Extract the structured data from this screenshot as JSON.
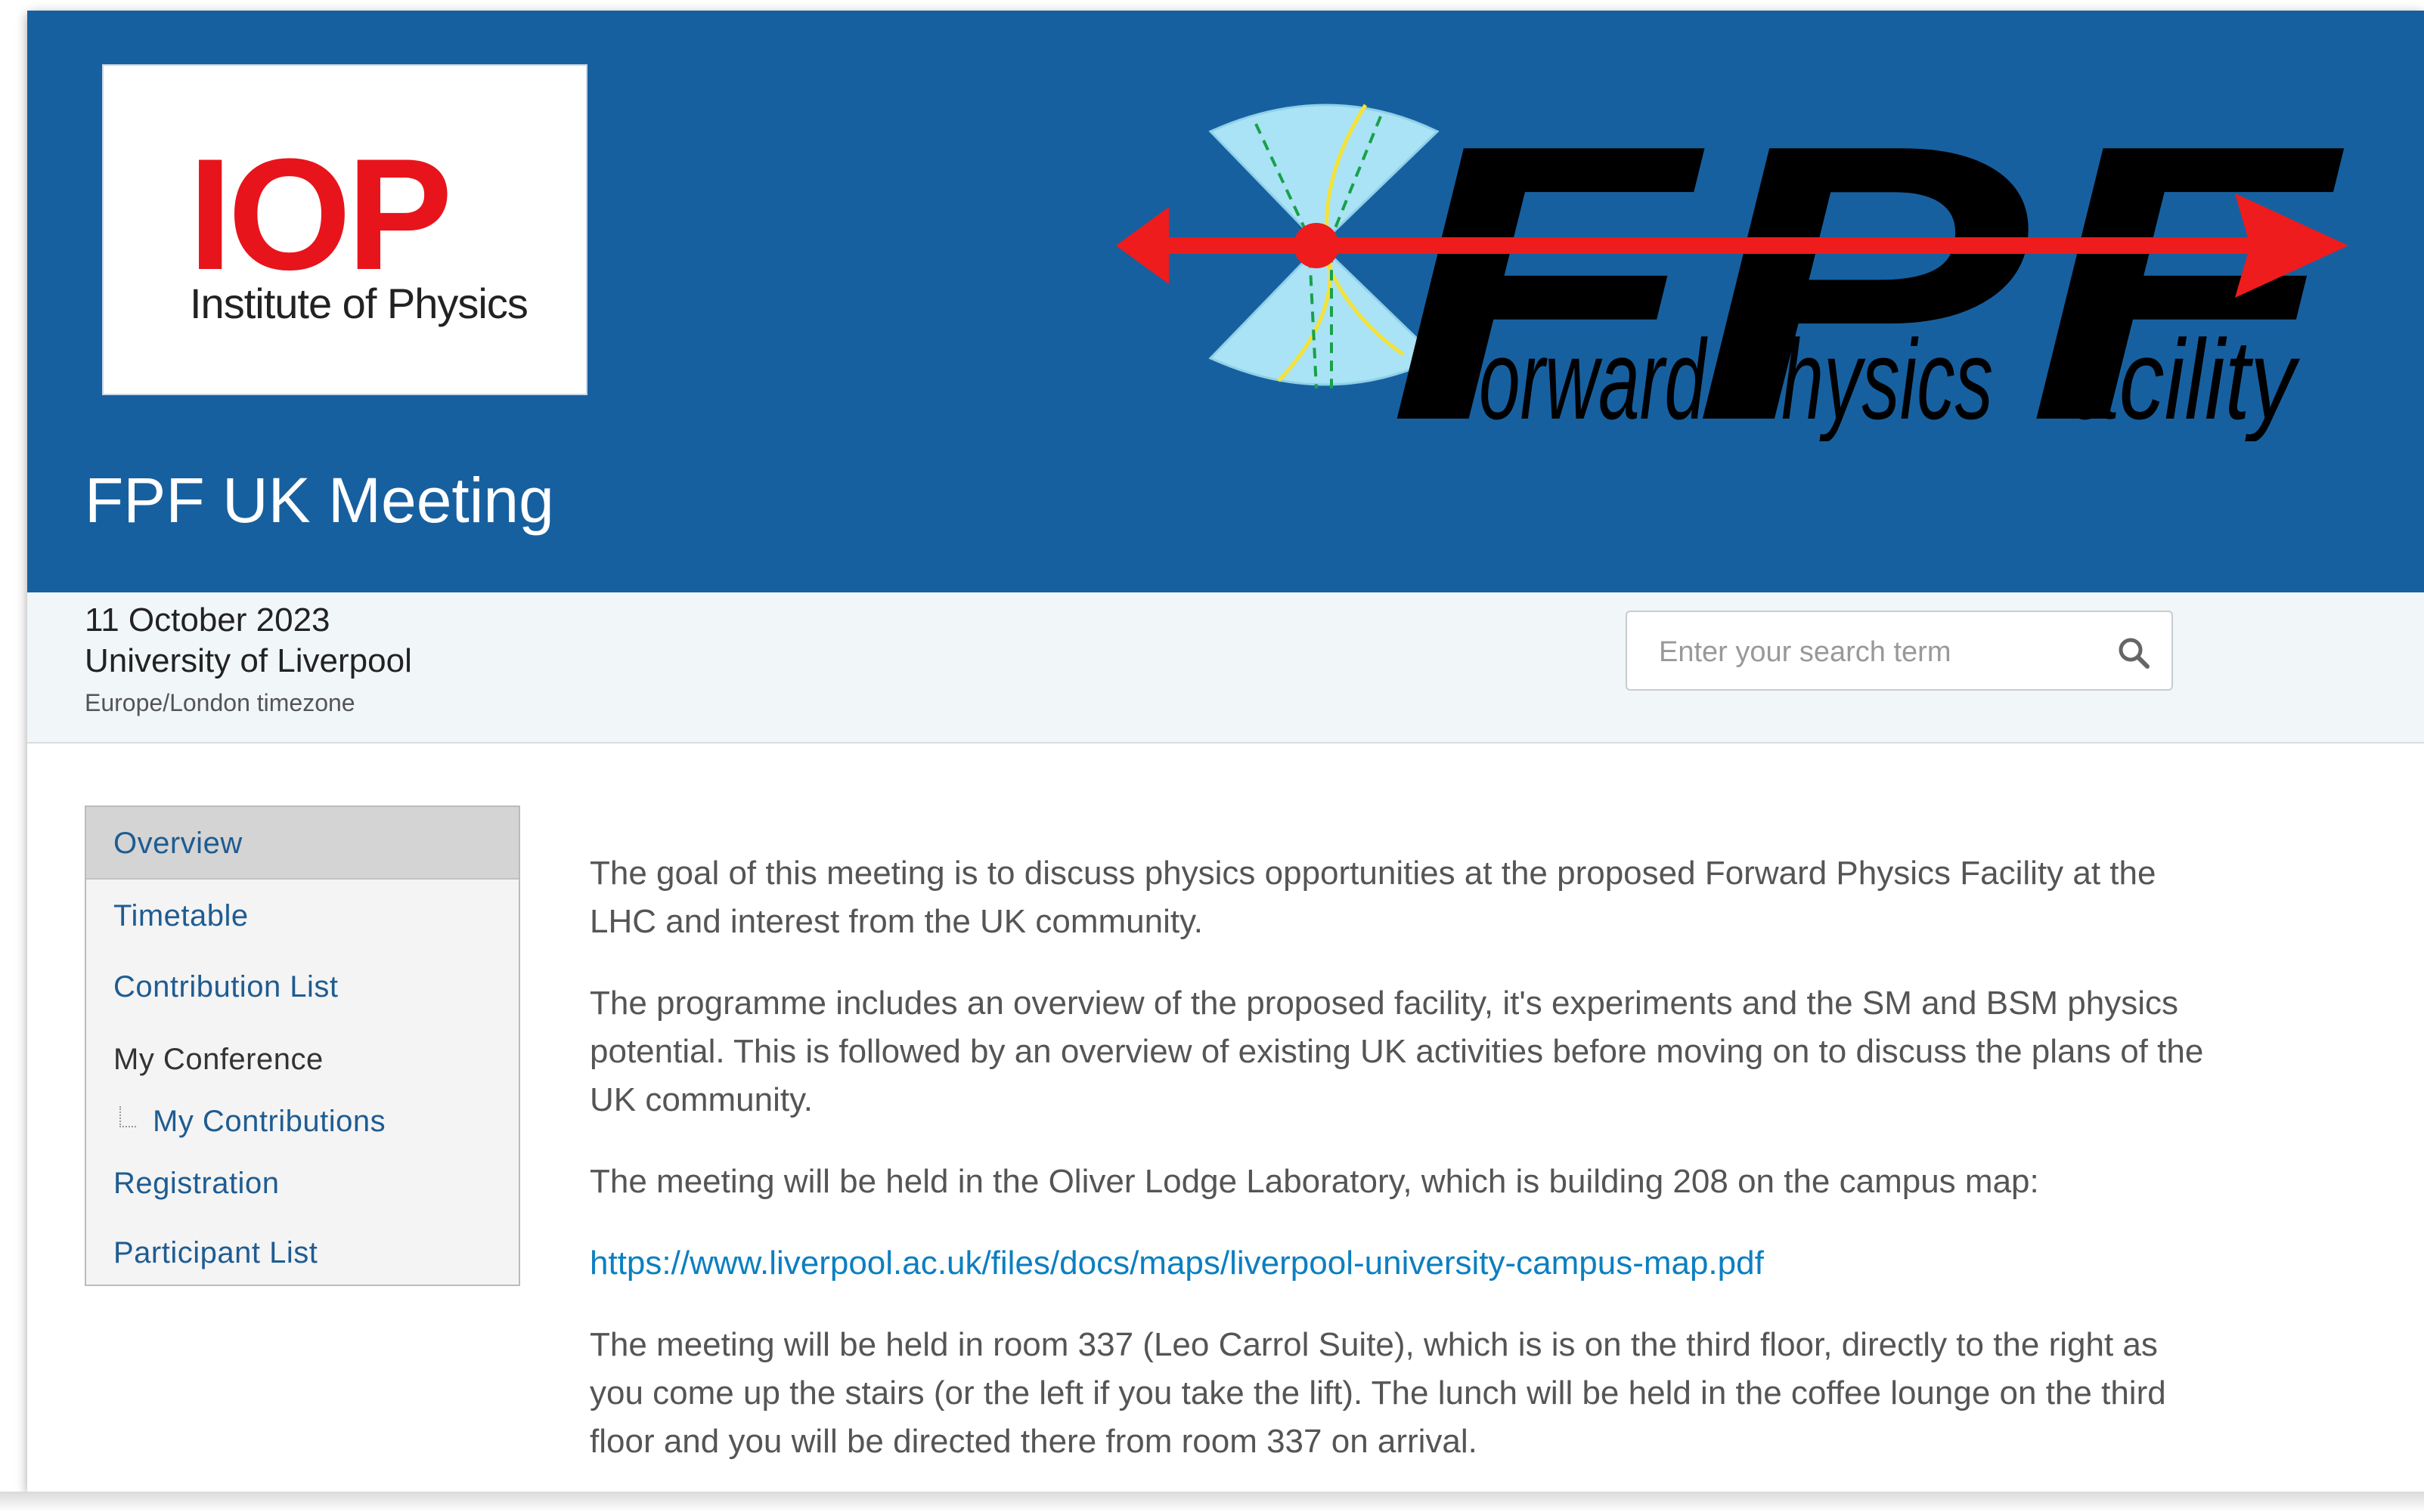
{
  "header": {
    "iop_logo": {
      "mark": "IOP",
      "subtitle": "Institute of Physics"
    },
    "fpf_logo": {
      "mark": "FPF",
      "words": [
        "orward",
        "hysics",
        "acility"
      ]
    },
    "title": "FPF UK Meeting",
    "colors": {
      "header_bg": "#1760a0",
      "iop_red": "#e8141c",
      "arrow_red": "#ee1c1c"
    }
  },
  "info": {
    "date": "11 October 2023",
    "venue": "University of Liverpool",
    "timezone": "Europe/London timezone"
  },
  "search": {
    "placeholder": "Enter your search term",
    "icon": "magnifier-icon"
  },
  "menu": {
    "items": [
      {
        "label": "Overview"
      },
      {
        "label": "Timetable"
      },
      {
        "label": "Contribution List"
      },
      {
        "label": "My Conference"
      },
      {
        "label": "My Contributions"
      },
      {
        "label": "Registration"
      },
      {
        "label": "Participant List"
      }
    ]
  },
  "content": {
    "p1": "The goal of this meeting is to discuss physics opportunities at the proposed Forward Physics Facility at the LHC and interest from the UK community.",
    "p2": "The programme includes an overview of the proposed facility, it's experiments and the SM and BSM physics potential. This is followed by an overview of existing UK activities before moving on to discuss the plans of the UK community.",
    "p3": "The meeting will be held in the Oliver Lodge Laboratory, which is  building 208 on the campus map:",
    "link": "https://www.liverpool.ac.uk/files/docs/maps/liverpool-university-campus-map.pdf",
    "p4": "The meeting will be held in room 337 (Leo Carrol Suite), which is  is on the third floor, directly to the right as you come up the stairs (or the left if you take the lift).   The lunch will be held in the coffee lounge on the third floor and you will be directed there from room 337 on arrival."
  }
}
